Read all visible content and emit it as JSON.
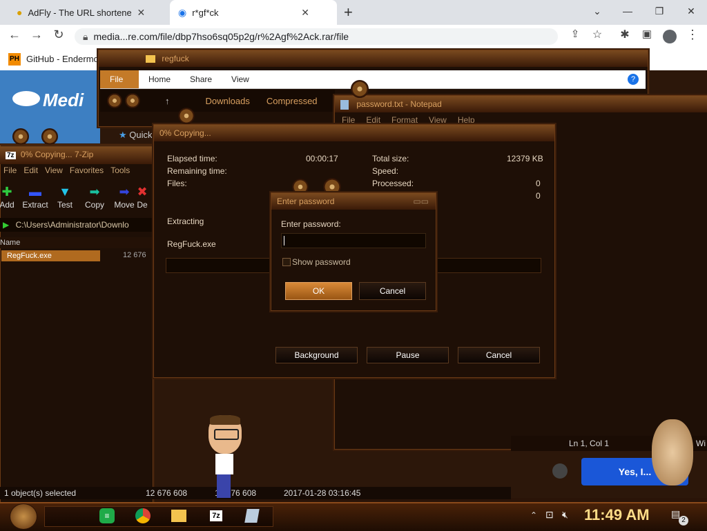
{
  "browser": {
    "tabs": [
      {
        "title": "AdFly - The URL shortener se",
        "icon": "bee-favicon-icon"
      },
      {
        "title": "r*gf*ck",
        "icon": "adfly-favicon-icon"
      }
    ],
    "url": "media...re.com/file/dbp7hso6sq05p2g/r%2Agf%2Ack.rar/file",
    "bookmarks": [
      {
        "label": "GitHub - Endermo"
      }
    ]
  },
  "page": {
    "banner_text": "Medi",
    "button_text": "Yes, I..."
  },
  "explorer": {
    "title": "regfuck",
    "ribbon_tabs": [
      "File",
      "Home",
      "Share",
      "View"
    ],
    "breadcrumb": [
      "Downloads",
      "Compressed"
    ],
    "quick_access": "Quick"
  },
  "notepad": {
    "title": "password.txt - Notepad",
    "menu": [
      "File",
      "Edit",
      "Format",
      "View",
      "Help"
    ],
    "status_pos": "Ln 1, Col 1",
    "status_extra": "Wi"
  },
  "sevenzip": {
    "title": "0% Copying... 7-Zip",
    "menu": [
      "File",
      "Edit",
      "View",
      "Favorites",
      "Tools"
    ],
    "toolbar": [
      "Add",
      "Extract",
      "Test",
      "Copy",
      "Move",
      "De"
    ],
    "path": "C:\\Users\\Administrator\\Downlo",
    "column_name": "Name",
    "row_file": "RegFuck.exe",
    "row_size": "12 676",
    "status": [
      "1 object(s) selected",
      "12 676 608",
      "12 676 608",
      "2017-01-28 03:16:45"
    ]
  },
  "copy_dialog": {
    "title": "0% Copying...",
    "elapsed_label": "Elapsed time:",
    "elapsed_value": "00:00:17",
    "remaining_label": "Remaining time:",
    "files_label": "Files:",
    "total_label": "Total size:",
    "total_value": "12379 KB",
    "speed_label": "Speed:",
    "processed_label": "Processed:",
    "processed_value": "0",
    "extra_value": "0",
    "extracting_label": "Extracting",
    "current_file": "RegFuck.exe",
    "progress": 0,
    "buttons": [
      "Background",
      "Pause",
      "Cancel"
    ]
  },
  "password_dialog": {
    "title": "Enter password",
    "prompt": "Enter password:",
    "value": "",
    "show_password_label": "Show password",
    "show_password_checked": false,
    "ok": "OK",
    "cancel": "Cancel"
  },
  "taskbar": {
    "time": "11:49 AM",
    "notification_count": "2",
    "apps": [
      "7z"
    ]
  }
}
